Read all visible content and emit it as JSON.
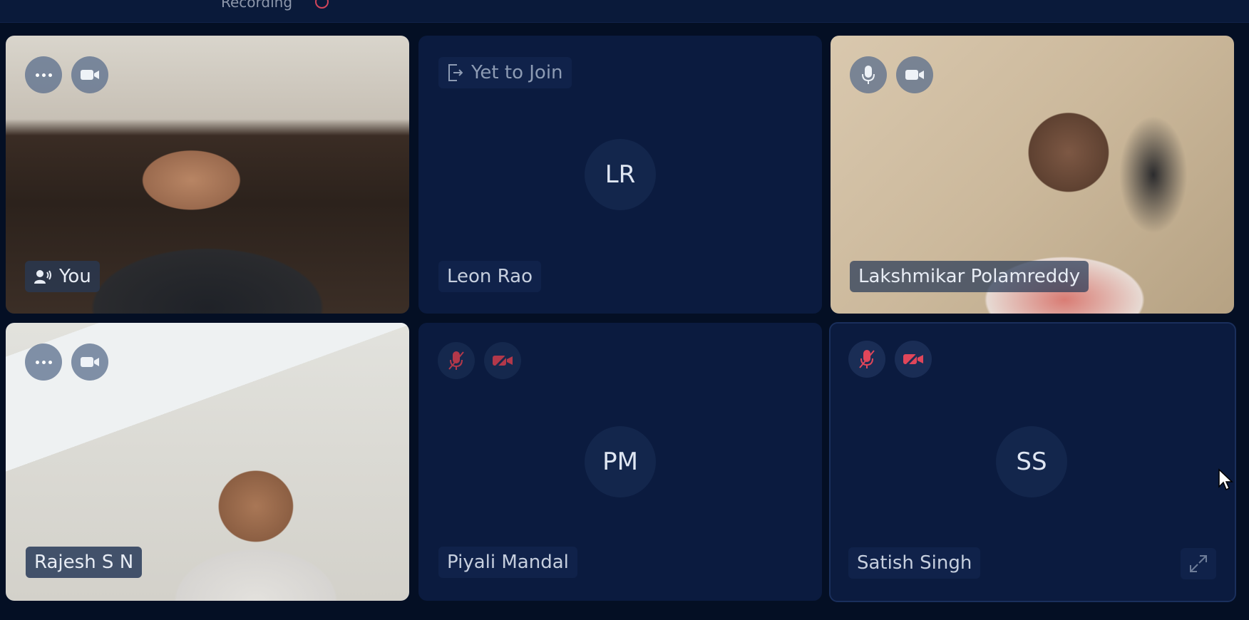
{
  "header": {
    "recording_label": "Recording"
  },
  "colors": {
    "background": "#040f24",
    "tile": "#0b1b3f",
    "muted_red": "#e0465a",
    "accent": "#10224a"
  },
  "tiles": {
    "you": {
      "name": "You"
    },
    "leon": {
      "status": "Yet to Join",
      "initials": "LR",
      "name": "Leon Rao"
    },
    "lakshmikar": {
      "name": "Lakshmikar Polamreddy"
    },
    "rajesh": {
      "name": "Rajesh S N"
    },
    "piyali": {
      "initials": "PM",
      "name": "Piyali Mandal"
    },
    "satish": {
      "initials": "SS",
      "name": "Satish Singh"
    }
  },
  "icons": [
    "more-icon",
    "video-camera-icon",
    "leave-icon",
    "microphone-icon",
    "mic-muted-icon",
    "video-off-icon",
    "speaker-icon",
    "expand-icon",
    "cursor-icon"
  ]
}
